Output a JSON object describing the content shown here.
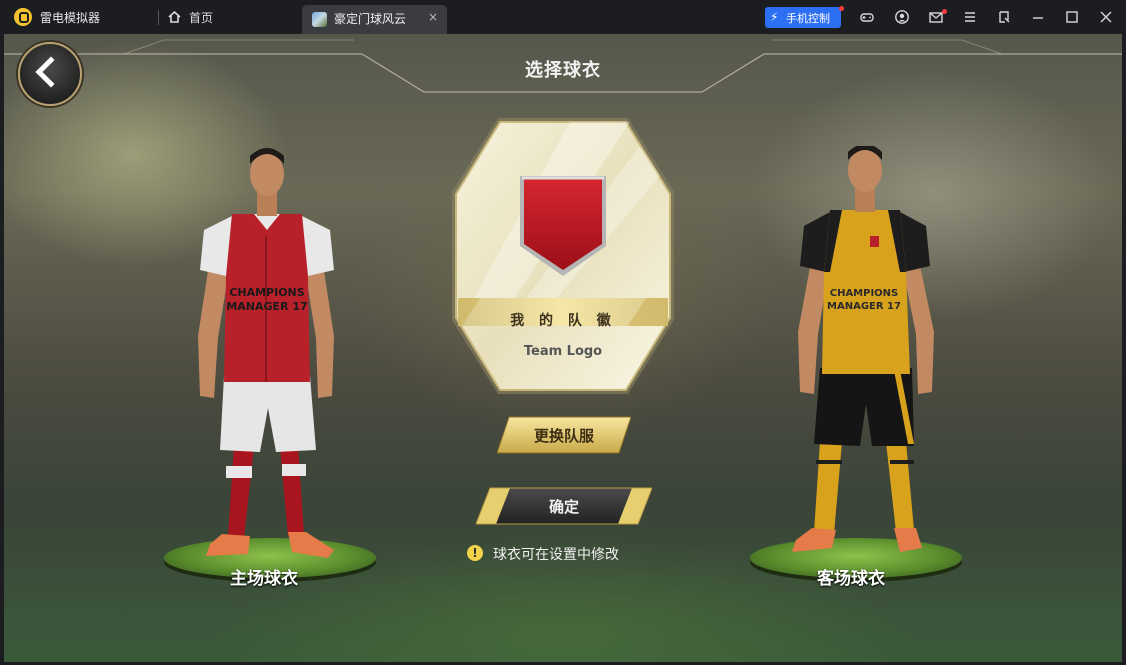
{
  "titlebar": {
    "app_name": "雷电模拟器",
    "home_tab": "首页",
    "active_tab": "豪定门球风云",
    "tab_close": "×",
    "phone_control": "手机控制",
    "icons": [
      "gamepad-icon",
      "user-icon",
      "mail-icon",
      "menu-icon",
      "resize-icon",
      "minimize-icon",
      "maximize-icon",
      "close-icon"
    ]
  },
  "game": {
    "title": "选择球衣",
    "badge": {
      "label_cn": "我 的 队 徽",
      "label_en": "Team Logo",
      "shield_color": "#c0151f"
    },
    "change_kit_button": "更换队服",
    "confirm_button": "确定",
    "tip_icon": "!",
    "tip_text": "球衣可在设置中修改",
    "home_kit_label": "主场球衣",
    "away_kit_label": "客场球衣",
    "home_kit": {
      "shirt_text": "CHAMPIONS MANAGER 17",
      "shirt_color": "#b8202a",
      "sleeve_color": "#e8e8e8",
      "shorts_color": "#e6e6e6",
      "socks_color": "#a8151e"
    },
    "away_kit": {
      "shirt_text": "CHAMPIONS MANAGER 17",
      "shirt_color": "#d9a21c",
      "trim_color": "#1d1d1d",
      "shorts_color": "#151515",
      "socks_color": "#d9a21c"
    }
  }
}
